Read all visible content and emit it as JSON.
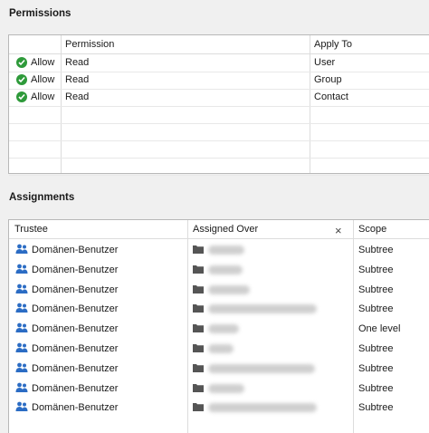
{
  "permissions": {
    "title": "Permissions",
    "columns": [
      "",
      "Permission",
      "Apply To"
    ],
    "rows": [
      {
        "effect": "Allow",
        "permission": "Read",
        "apply_to": "User"
      },
      {
        "effect": "Allow",
        "permission": "Read",
        "apply_to": "Group"
      },
      {
        "effect": "Allow",
        "permission": "Read",
        "apply_to": "Contact"
      }
    ]
  },
  "assignments": {
    "title": "Assignments",
    "columns": {
      "trustee": "Trustee",
      "assigned_over": "Assigned Over",
      "close": "×",
      "scope": "Scope"
    },
    "rows": [
      {
        "trustee": "Domänen-Benutzer",
        "scope": "Subtree"
      },
      {
        "trustee": "Domänen-Benutzer",
        "scope": "Subtree"
      },
      {
        "trustee": "Domänen-Benutzer",
        "scope": "Subtree"
      },
      {
        "trustee": "Domänen-Benutzer",
        "scope": "Subtree"
      },
      {
        "trustee": "Domänen-Benutzer",
        "scope": "One level"
      },
      {
        "trustee": "Domänen-Benutzer",
        "scope": "Subtree"
      },
      {
        "trustee": "Domänen-Benutzer",
        "scope": "Subtree"
      },
      {
        "trustee": "Domänen-Benutzer",
        "scope": "Subtree"
      },
      {
        "trustee": "Domänen-Benutzer",
        "scope": "Subtree"
      }
    ]
  },
  "colors": {
    "allow_green": "#2e9a3a",
    "users_icon_blue": "#2b6cc4",
    "folder_gray": "#555555"
  }
}
